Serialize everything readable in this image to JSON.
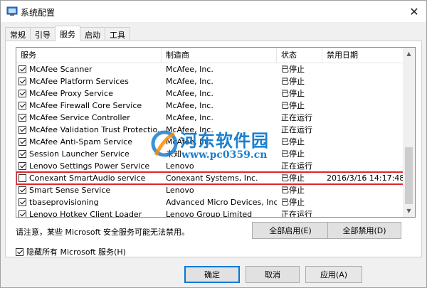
{
  "window": {
    "title": "系统配置",
    "close_glyph": "✕"
  },
  "tabs": [
    {
      "label": "常规",
      "active": false
    },
    {
      "label": "引导",
      "active": false
    },
    {
      "label": "服务",
      "active": true
    },
    {
      "label": "启动",
      "active": false
    },
    {
      "label": "工具",
      "active": false
    }
  ],
  "services": {
    "columns": [
      "服务",
      "制造商",
      "状态",
      "禁用日期"
    ],
    "rows": [
      {
        "name": "McAfee Scanner",
        "manufacturer": "McAfee, Inc.",
        "status": "已停止",
        "date": "",
        "checked": true
      },
      {
        "name": "McAfee Platform Services",
        "manufacturer": "McAfee, Inc.",
        "status": "已停止",
        "date": "",
        "checked": true
      },
      {
        "name": "McAfee Proxy Service",
        "manufacturer": "McAfee, Inc.",
        "status": "已停止",
        "date": "",
        "checked": true
      },
      {
        "name": "McAfee Firewall Core Service",
        "manufacturer": "McAfee, Inc.",
        "status": "已停止",
        "date": "",
        "checked": true
      },
      {
        "name": "McAfee Service Controller",
        "manufacturer": "McAfee, Inc.",
        "status": "正在运行",
        "date": "",
        "checked": true
      },
      {
        "name": "McAfee Validation Trust Protectio...",
        "manufacturer": "McAfee, Inc.",
        "status": "正在运行",
        "date": "",
        "checked": true
      },
      {
        "name": "McAfee Anti-Spam Service",
        "manufacturer": "McAfee, Inc.",
        "status": "已停止",
        "date": "",
        "checked": true
      },
      {
        "name": "Session Launcher Service",
        "manufacturer": "未知",
        "status": "已停止",
        "date": "",
        "checked": true
      },
      {
        "name": "Lenovo Settings Power Service",
        "manufacturer": "Lenovo",
        "status": "正在运行",
        "date": "",
        "checked": true
      },
      {
        "name": "Conexant SmartAudio service",
        "manufacturer": "Conexant Systems, Inc.",
        "status": "已停止",
        "date": "2016/3/16 14:17:48",
        "checked": false,
        "highlight": true
      },
      {
        "name": "Smart Sense Service",
        "manufacturer": "Lenovo",
        "status": "已停止",
        "date": "",
        "checked": true
      },
      {
        "name": "tbaseprovisioning",
        "manufacturer": "Advanced Micro Devices, Inc.",
        "status": "已停止",
        "date": "",
        "checked": true
      },
      {
        "name": "Lenovo Hotkey Client Loader",
        "manufacturer": "Lenovo Group Limited",
        "status": "正在运行",
        "date": "",
        "checked": true
      }
    ]
  },
  "note": "请注意，某些 Microsoft 安全服务可能无法禁用。",
  "buttons": {
    "enable_all": "全部启用(E)",
    "disable_all": "全部禁用(D)",
    "ok": "确定",
    "cancel": "取消",
    "apply": "应用(A)"
  },
  "hide_ms": {
    "label": "隐藏所有 Microsoft 服务(H)",
    "checked": true
  },
  "watermark": {
    "name": "河东软件园",
    "url": "www.pc0359.cn"
  },
  "colors": {
    "highlight_border": "#e0262b",
    "accent": "#0078d7",
    "watermark": "#1a7fd0"
  }
}
